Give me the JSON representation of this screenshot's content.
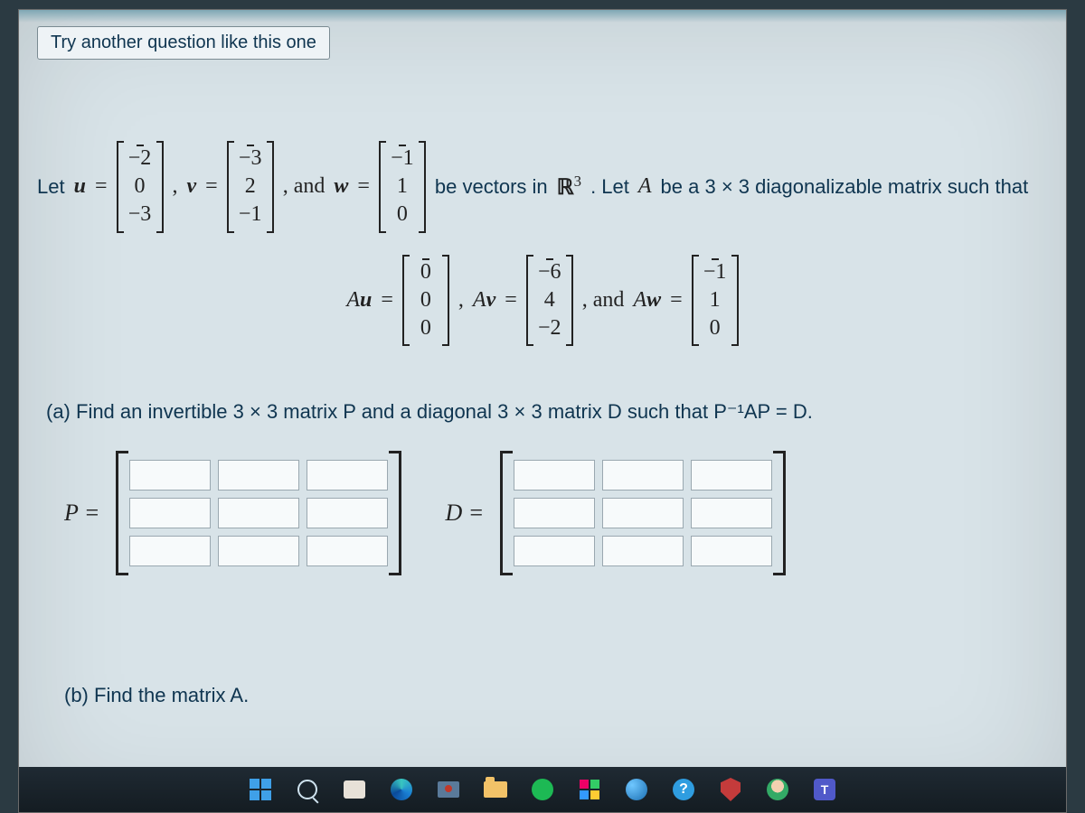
{
  "top_button": "Try another question like this one",
  "line1": {
    "let": "Let ",
    "u_eq": " =",
    "u": [
      "−2",
      "0",
      "−3"
    ],
    "comma_v": ", ",
    "v_eq": " =",
    "v": [
      "−3",
      "2",
      "−1"
    ],
    "and_w": ", and ",
    "w_eq": " =",
    "w": [
      "−1",
      "1",
      "0"
    ],
    "tail_a": " be vectors in ",
    "r3": "ℝ",
    "r3_sup": "3",
    "tail_b": ". Let ",
    "A": "A",
    "tail_c": " be a 3 × 3 diagonalizable matrix such that"
  },
  "line2": {
    "Au_eq": " =",
    "Au": [
      "0",
      "0",
      "0"
    ],
    "sep1": ",   ",
    "Av_eq": " =",
    "Av": [
      "−6",
      "4",
      "−2"
    ],
    "sep2": ",   and  ",
    "Aw_eq": " =",
    "Aw": [
      "−1",
      "1",
      "0"
    ]
  },
  "part_a": "(a) Find an invertible 3 × 3 matrix P and a diagonal 3 × 3 matrix D such that P⁻¹AP = D.",
  "answers": {
    "P_label": "P =",
    "D_label": "D ="
  },
  "part_b": "(b) Find the matrix A.",
  "labels": {
    "u": "u",
    "v": "v",
    "w": "w",
    "Au": "Au",
    "Av": "Av",
    "Aw": "Aw"
  },
  "taskbar_icons": [
    "start-icon",
    "search-icon",
    "chat-icon",
    "edge-icon",
    "camera-icon",
    "folder-icon",
    "spotify-icon",
    "grid-icon",
    "globe-icon",
    "help-icon",
    "shield-icon",
    "avatar-icon",
    "teams-icon"
  ]
}
